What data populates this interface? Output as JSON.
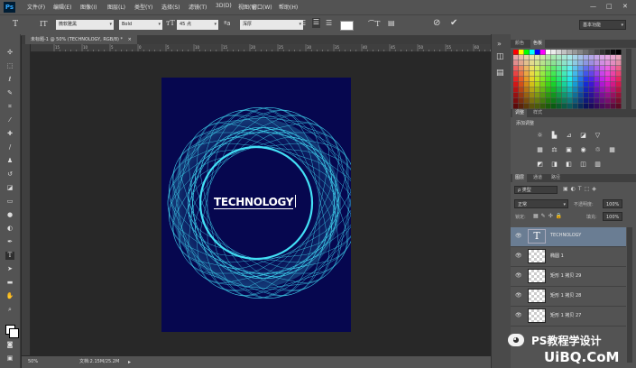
{
  "app": {
    "logo": "Ps"
  },
  "menus": [
    "文件(F)",
    "编辑(E)",
    "图像(I)",
    "图层(L)",
    "类型(Y)",
    "选择(S)",
    "滤镜(T)",
    "3D(D)",
    "视图(V)",
    "窗口(W)",
    "帮助(H)"
  ],
  "window_controls": {
    "minimize": "—",
    "maximize": "□",
    "close": "✕"
  },
  "options": {
    "font_family": "微软雅黑",
    "font_style": "Bold",
    "font_size": "45 点",
    "anti_alias": "浑厚",
    "workspace": "基本功能"
  },
  "document": {
    "tab_title": "未标题-1 @ 50% (TECHNOLOGY, RGB/8) *",
    "close": "×",
    "canvas_text": "TECHNOLOGY",
    "background_color": "#06074f",
    "ring_color": "#3fd6f0"
  },
  "ruler": {
    "labels": [
      "15",
      "10",
      "5",
      "0",
      "5",
      "10",
      "15",
      "20",
      "25",
      "30",
      "35",
      "40",
      "45",
      "50",
      "55",
      "60"
    ]
  },
  "status": {
    "zoom": "50%",
    "doc_info": "文档:2.15M/25.2M"
  },
  "panels": {
    "swatches_tabs": [
      "颜色",
      "色板"
    ],
    "adjust_tabs": [
      "调整",
      "样式"
    ],
    "adjust_title": "添加调整",
    "layers_tabs": [
      "图层",
      "通道",
      "路径"
    ],
    "filter_label": "ρ 类型",
    "blend_mode": "正常",
    "opacity_label": "不透明度:",
    "opacity_value": "100%",
    "lock_label": "锁定:",
    "fill_label": "填充:",
    "fill_value": "100%"
  },
  "layers": [
    {
      "name": "TECHNOLOGY",
      "type": "text",
      "selected": true
    },
    {
      "name": "椭圆 1",
      "type": "shape",
      "selected": false
    },
    {
      "name": "矩形 1 拷贝 29",
      "type": "shape",
      "selected": false
    },
    {
      "name": "矩形 1 拷贝 28",
      "type": "shape",
      "selected": false
    },
    {
      "name": "矩形 1 拷贝 27",
      "type": "shape",
      "selected": false
    }
  ],
  "watermark": {
    "text": "PS教程学设计",
    "site": "UiBQ.CoM"
  }
}
